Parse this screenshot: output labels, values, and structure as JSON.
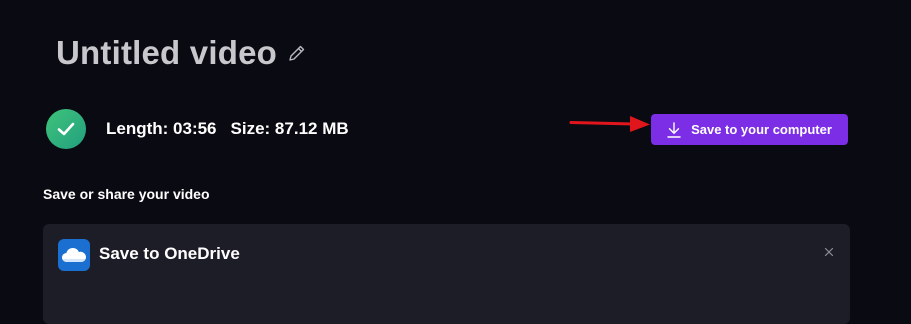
{
  "video": {
    "title": "Untitled video",
    "length_text": "Length: 03:56",
    "size_text": "Size: 87.12 MB"
  },
  "actions": {
    "save_computer_label": "Save to your computer"
  },
  "share": {
    "heading": "Save or share your video",
    "onedrive_title": "Save to OneDrive"
  },
  "icons": {
    "edit": "pencil-icon",
    "status": "checkmark-icon",
    "download": "download-icon",
    "onedrive": "onedrive-cloud-icon",
    "close": "close-icon",
    "annotation": "red-arrow"
  },
  "colors": {
    "background": "#0a0a12",
    "accent": "#7c2ee6",
    "success": "#3fc37a",
    "card": "#1d1d27",
    "onedrive": "#1a6fd1",
    "annotation": "#e0161c"
  }
}
